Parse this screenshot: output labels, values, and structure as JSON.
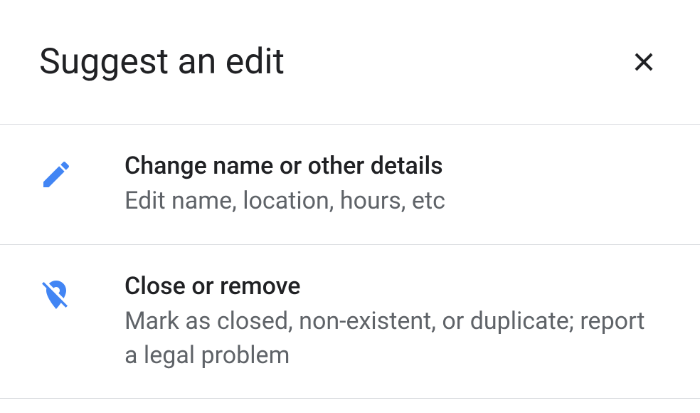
{
  "header": {
    "title": "Suggest an edit"
  },
  "options": [
    {
      "title": "Change name or other details",
      "description": "Edit name, location, hours, etc"
    },
    {
      "title": "Close or remove",
      "description": "Mark as closed, non-existent, or duplicate; report a legal problem"
    }
  ]
}
